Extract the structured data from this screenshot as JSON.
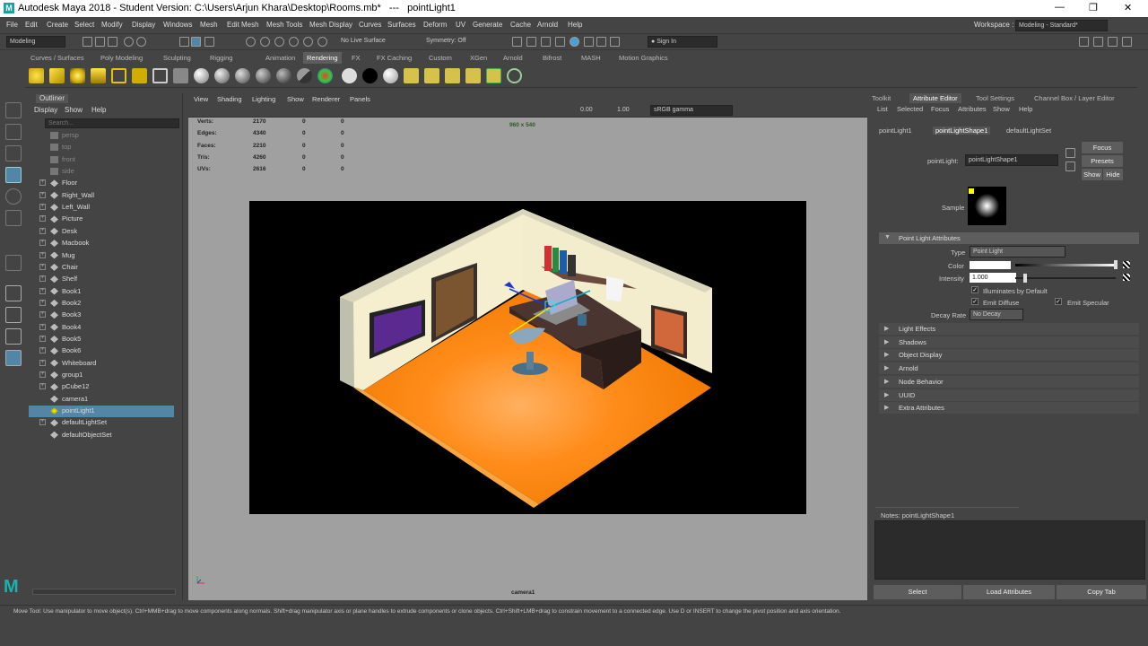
{
  "title": {
    "app": "Autodesk Maya 2018 - Student Version: C:\\Users\\Arjun Khara\\Desktop\\Rooms.mb*",
    "separator": "---",
    "object": "pointLight1"
  },
  "menubar": [
    "File",
    "Edit",
    "Create",
    "Select",
    "Modify",
    "Display",
    "Windows",
    "Mesh",
    "Edit Mesh",
    "Mesh Tools",
    "Mesh Display",
    "Curves",
    "Surfaces",
    "Deform",
    "UV",
    "Generate",
    "Cache",
    "Arnold",
    "Help"
  ],
  "workspace": {
    "label": "Workspace :",
    "value": "Modeling - Standard*"
  },
  "status": {
    "mode": "Modeling",
    "live_surface": "No Live Surface",
    "symmetry": "Symmetry: Off",
    "sign_in": "Sign In"
  },
  "shelf_tabs": [
    "Curves / Surfaces",
    "Poly Modeling",
    "Sculpting",
    "Rigging",
    "Animation",
    "Rendering",
    "FX",
    "FX Caching",
    "Custom",
    "XGen",
    "Arnold",
    "Bifrost",
    "MASH",
    "Motion Graphics"
  ],
  "active_shelf": "Rendering",
  "outliner": {
    "title": "Outliner",
    "menu": [
      "Display",
      "Show",
      "Help"
    ],
    "search_placeholder": "Search...",
    "items": [
      {
        "label": "persp",
        "dim": true
      },
      {
        "label": "top",
        "dim": true
      },
      {
        "label": "front",
        "dim": true
      },
      {
        "label": "side",
        "dim": true
      },
      {
        "label": "Floor",
        "exp": true
      },
      {
        "label": "Right_Wall",
        "exp": true
      },
      {
        "label": "Left_Wall",
        "exp": true
      },
      {
        "label": "Picture",
        "exp": true
      },
      {
        "label": "Desk",
        "exp": true
      },
      {
        "label": "Macbook",
        "exp": true
      },
      {
        "label": "Mug",
        "exp": true
      },
      {
        "label": "Chair",
        "exp": true
      },
      {
        "label": "Shelf",
        "exp": true
      },
      {
        "label": "Book1",
        "exp": true
      },
      {
        "label": "Book2",
        "exp": true
      },
      {
        "label": "Book3",
        "exp": true
      },
      {
        "label": "Book4",
        "exp": true
      },
      {
        "label": "Book5",
        "exp": true
      },
      {
        "label": "Book6",
        "exp": true
      },
      {
        "label": "Whiteboard",
        "exp": true
      },
      {
        "label": "group1",
        "exp": true
      },
      {
        "label": "pCube12",
        "exp": true
      },
      {
        "label": "camera1"
      },
      {
        "label": "pointLight1",
        "sel": true
      },
      {
        "label": "defaultLightSet",
        "exp": true
      },
      {
        "label": "defaultObjectSet"
      }
    ]
  },
  "viewport": {
    "menu": [
      "View",
      "Shading",
      "Lighting",
      "Show",
      "Renderer",
      "Panels"
    ],
    "exposure": "0.00",
    "gamma": "1.00",
    "colorspace": "sRGB gamma",
    "resolution": "960 x 540",
    "camera": "camera1",
    "stats": [
      {
        "label": "Verts:",
        "v": "2170",
        "a": "0",
        "b": "0"
      },
      {
        "label": "Edges:",
        "v": "4340",
        "a": "0",
        "b": "0"
      },
      {
        "label": "Faces:",
        "v": "2210",
        "a": "0",
        "b": "0"
      },
      {
        "label": "Tris:",
        "v": "4260",
        "a": "0",
        "b": "0"
      },
      {
        "label": "UVs:",
        "v": "2616",
        "a": "0",
        "b": "0"
      }
    ]
  },
  "attr": {
    "tabs": [
      "Toolkit",
      "Attribute Editor",
      "Tool Settings",
      "Channel Box / Layer Editor"
    ],
    "menu": [
      "List",
      "Selected",
      "Focus",
      "Attributes",
      "Show",
      "Help"
    ],
    "node_tabs": [
      "pointLight1",
      "pointLightShape1",
      "defaultLightSet"
    ],
    "node_label": "pointLight:",
    "node_value": "pointLightShape1",
    "focus": "Focus",
    "presets": "Presets",
    "show": "Show",
    "hide": "Hide",
    "sample": "Sample",
    "section": "Point Light Attributes",
    "type_label": "Type",
    "type_value": "Point Light",
    "color_label": "Color",
    "intensity_label": "Intensity",
    "intensity_value": "1.000",
    "illum": "Illuminates by Default",
    "emit_diffuse": "Emit Diffuse",
    "emit_specular": "Emit Specular",
    "decay_label": "Decay Rate",
    "decay_value": "No Decay",
    "sections": [
      "Light Effects",
      "Shadows",
      "Object Display",
      "Arnold",
      "Node Behavior",
      "UUID",
      "Extra Attributes"
    ],
    "notes": "Notes:  pointLightShape1",
    "bottom": [
      "Select",
      "Load Attributes",
      "Copy Tab"
    ]
  },
  "help": "Move Tool: Use manipulator to move object(s). Ctrl+MMB+drag to move components along normals. Shift+drag manipulator axis or plane handles to extrude components or clone objects. Ctrl+Shift+LMB+drag to constrain movement to a connected edge. Use D or INSERT to change the pivot position and axis orientation."
}
